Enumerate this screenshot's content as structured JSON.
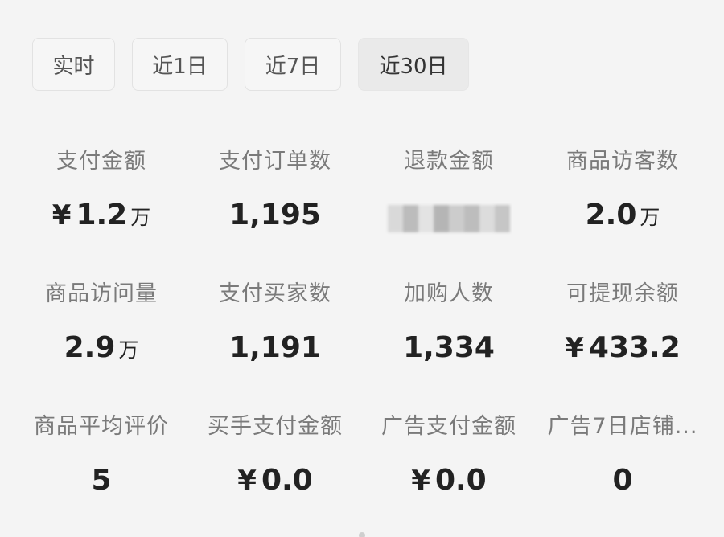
{
  "tabs": [
    "实时",
    "近1日",
    "近7日",
    "近30日"
  ],
  "active_tab": "近30日",
  "metrics": [
    {
      "label": "支付金额",
      "currency": "¥",
      "value": "1.2",
      "unit": "万"
    },
    {
      "label": "支付订单数",
      "currency": "",
      "value": "1,195",
      "unit": ""
    },
    {
      "label": "退款金额",
      "currency": "",
      "value": "",
      "unit": "",
      "blurred": true
    },
    {
      "label": "商品访客数",
      "currency": "",
      "value": "2.0",
      "unit": "万"
    },
    {
      "label": "商品访问量",
      "currency": "",
      "value": "2.9",
      "unit": "万"
    },
    {
      "label": "支付买家数",
      "currency": "",
      "value": "1,191",
      "unit": ""
    },
    {
      "label": "加购人数",
      "currency": "",
      "value": "1,334",
      "unit": ""
    },
    {
      "label": "可提现余额",
      "currency": "¥",
      "value": "433.2",
      "unit": ""
    },
    {
      "label": "商品平均评价",
      "currency": "",
      "value": "5",
      "unit": ""
    },
    {
      "label": "买手支付金额",
      "currency": "¥",
      "value": "0.0",
      "unit": ""
    },
    {
      "label": "广告支付金额",
      "currency": "¥",
      "value": "0.0",
      "unit": ""
    },
    {
      "label": "广告7日店铺...",
      "currency": "",
      "value": "0",
      "unit": ""
    }
  ],
  "colors": {
    "background": "#f4f4f4",
    "label": "#7a7a7a",
    "value": "#222222",
    "tab_active_bg": "#eaeaea"
  }
}
